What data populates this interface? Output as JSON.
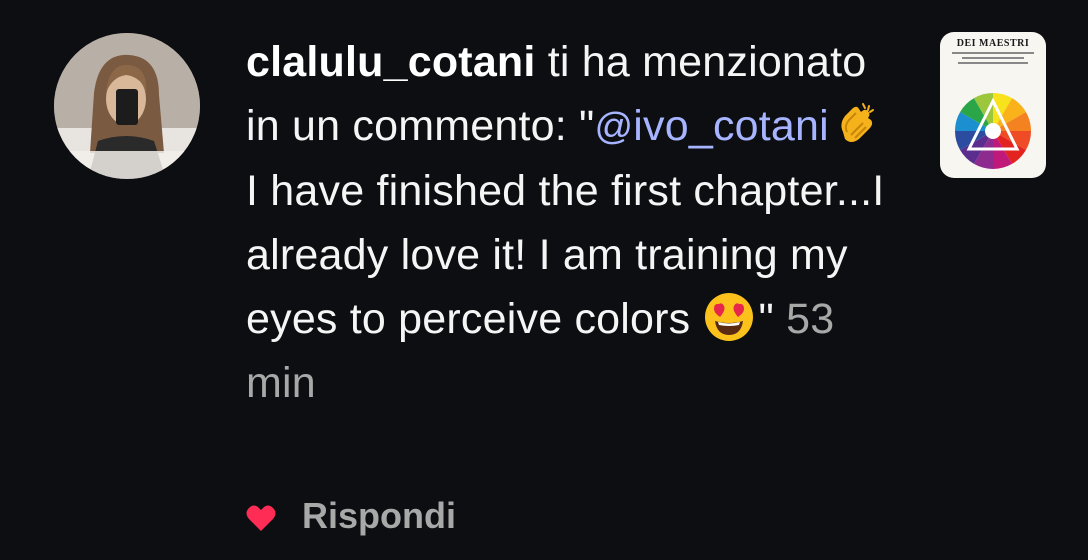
{
  "notification": {
    "username": "clalulu_cotani",
    "action_text": " ti ha menzionato in un commento: ",
    "quote_open": "\"",
    "mention": "ivo_cotani",
    "mention_icon": "threads-at-icon",
    "comment_text": " I have finished the first chapter...I already love it! I am training my eyes to perceive colors ",
    "quote_close": "\" ",
    "time": "53 min",
    "emojis": [
      "clapping-hands",
      "heart-eyes-face"
    ]
  },
  "actions": {
    "like_icon": "heart-icon",
    "like_color": "#ff2d55",
    "reply_label": "Rispondi"
  },
  "thumbnail": {
    "book_title": "DEI MAESTRI"
  },
  "colors": {
    "background": "#0c0e12",
    "mention": "#a7b4ff",
    "secondary_text": "#a8a8a8"
  }
}
